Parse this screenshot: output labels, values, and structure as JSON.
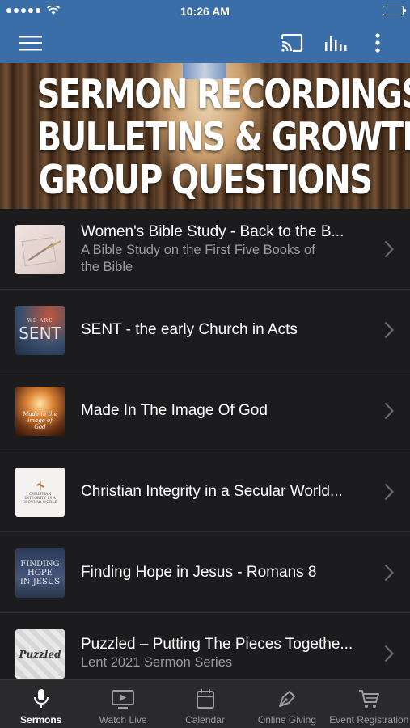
{
  "status_bar": {
    "time": "10:26 AM"
  },
  "hero": {
    "line1": "SERMON RECORDINGS,",
    "line2": "BULLETINS & GROWTH",
    "line3": "GROUP QUESTIONS"
  },
  "items": [
    {
      "title": "Women's Bible Study - Back to the B...",
      "subtitle_line1": "A Bible Study on the First Five Books of",
      "subtitle_line2": "the Bible"
    },
    {
      "title": "SENT - the early Church in Acts",
      "thumb_text_small": "WE ARE",
      "thumb_text_big": "SENT"
    },
    {
      "title": "Made In The Image Of God",
      "thumb_text": "Made in the image of God"
    },
    {
      "title": "Christian Integrity in a Secular World...",
      "thumb_text": "CHRISTIAN INTEGRITY IN A SECULAR WORLD"
    },
    {
      "title": "Finding Hope in Jesus - Romans 8",
      "thumb_line1": "FINDING",
      "thumb_line2": "HOPE",
      "thumb_line3": "IN JESUS"
    },
    {
      "title": "Puzzled – Putting The Pieces Togethe...",
      "subtitle_line1": "Lent 2021 Sermon Series",
      "thumb_text": "Puzzled"
    }
  ],
  "tabs": [
    {
      "label": "Sermons",
      "icon": "microphone-icon",
      "active": true
    },
    {
      "label": "Watch Live",
      "icon": "tv-play-icon"
    },
    {
      "label": "Calendar",
      "icon": "calendar-icon"
    },
    {
      "label": "Online Giving",
      "icon": "pen-nib-icon"
    },
    {
      "label": "Event Registration",
      "icon": "cart-icon"
    }
  ],
  "colors": {
    "app_bar": "#3a6ea8",
    "background": "#1c1c1e",
    "tab_bar": "#2a2a2d"
  }
}
